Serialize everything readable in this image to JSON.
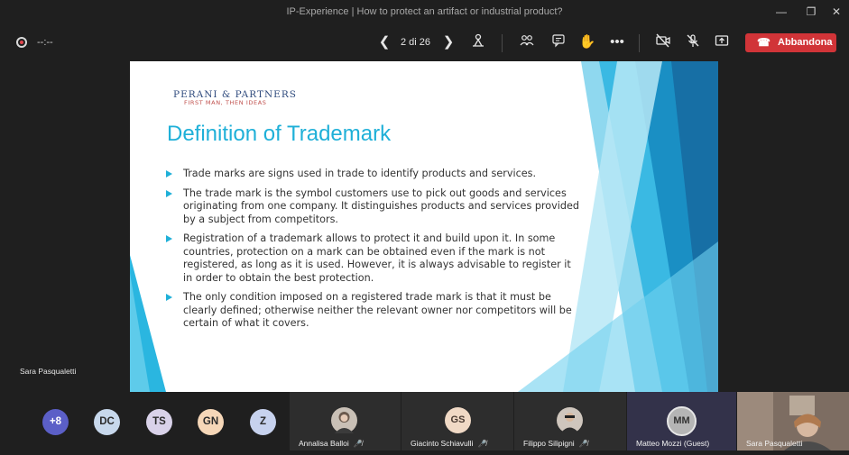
{
  "window": {
    "title": "IP-Experience | How to protect an artifact or industrial product?"
  },
  "toolbar": {
    "timer": "--:--",
    "page_indicator": "2 di 26",
    "leave_label": "Abbandona",
    "leave_color": "#d13438"
  },
  "slide": {
    "logo_main": "Perani & Partners",
    "logo_sub": "FIRST MAN, THEN IDEAS",
    "title": "Definition of Trademark",
    "accent": "#1fb0d8",
    "bullets": [
      "Trade marks are signs used in trade to identify products and services.",
      "The trade mark is the symbol customers use to pick out goods and services originating from one company. It distinguishes products and services provided by a subject from competitors.",
      "Registration of a trademark allows to protect it and build upon it. In some countries, protection on a mark can be obtained even if the mark is not registered, as long as it is used. However, it is always advisable to register it in order to obtain the best protection.",
      "The only condition imposed on a registered trade mark is that it must be clearly defined; otherwise neither the relevant owner nor competitors will be certain of what it covers."
    ]
  },
  "presenter": {
    "name": "Sara Pasqualetti"
  },
  "participants": {
    "bubbles": [
      {
        "initials": "+8",
        "color": "#5b5fc7"
      },
      {
        "initials": "DC",
        "color": "#c7d8ec"
      },
      {
        "initials": "TS",
        "color": "#d9d2e9"
      },
      {
        "initials": "GN",
        "color": "#f6d7b8"
      },
      {
        "initials": "Z",
        "color": "#c7d2ee"
      }
    ],
    "tiles": [
      {
        "name": "Annalisa Balloi"
      },
      {
        "name": "Giacinto Schiavulli",
        "initials": "GS"
      },
      {
        "name": "Filippo Silipigni"
      },
      {
        "name": "Matteo Mozzi (Guest)",
        "initials": "MM"
      },
      {
        "name": "Sara Pasqualetti"
      }
    ]
  },
  "icons": [
    "record-icon",
    "prev-slide-icon",
    "next-slide-icon",
    "pointer-icon",
    "participants-icon",
    "chat-icon",
    "raise-hand-icon",
    "more-icon",
    "camera-off-icon",
    "mic-off-icon",
    "share-icon",
    "phone-hangup-icon"
  ]
}
